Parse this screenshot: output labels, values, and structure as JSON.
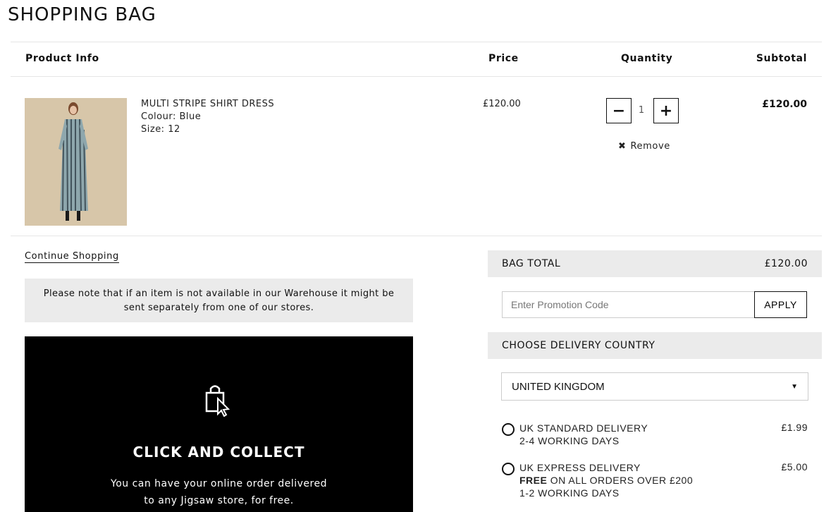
{
  "page": {
    "title": "SHOPPING BAG"
  },
  "table_headers": {
    "product": "Product Info",
    "price": "Price",
    "quantity": "Quantity",
    "subtotal": "Subtotal"
  },
  "item": {
    "name": "MULTI STRIPE SHIRT DRESS",
    "colour": "Colour: Blue",
    "size": "Size: 12",
    "price": "£120.00",
    "quantity": "1",
    "subtotal": "£120.00",
    "remove_label": "Remove",
    "decrease_symbol": "−",
    "increase_symbol": "+"
  },
  "continue_label": "Continue Shopping",
  "notice": "Please note that if an item is not available in our Warehouse it might be sent separately from one of our stores.",
  "click_collect": {
    "icon": "shopping-bag-cursor-icon",
    "title": "CLICK AND COLLECT",
    "line1": "You can have your online order delivered",
    "line2": "to any Jigsaw store, for free."
  },
  "summary": {
    "bag_total_label": "BAG TOTAL",
    "bag_total_value": "£120.00",
    "promo_placeholder": "Enter Promotion Code",
    "apply_label": "APPLY",
    "delivery_country_label": "CHOOSE DELIVERY COUNTRY",
    "country_selected": "UNITED KINGDOM",
    "delivery_options": [
      {
        "name": "UK STANDARD DELIVERY",
        "line2": "2-4 WORKING DAYS",
        "cost": "£1.99"
      },
      {
        "name": "UK EXPRESS DELIVERY",
        "free_bold": "FREE",
        "free_rest": " ON ALL ORDERS OVER £200",
        "line3": "1-2 WORKING DAYS",
        "cost": "£5.00"
      }
    ]
  },
  "colors": {
    "panel_gray": "#ebebeb",
    "promo_black": "#000000"
  }
}
